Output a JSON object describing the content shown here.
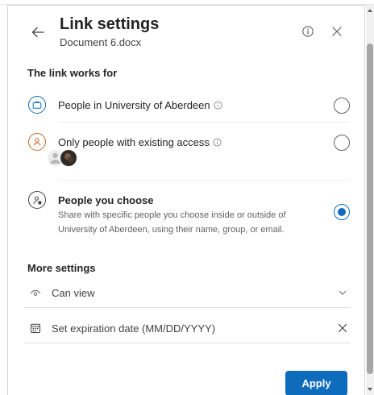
{
  "header": {
    "title": "Link settings",
    "document_name": "Document 6.docx"
  },
  "link_works_for": {
    "heading": "The link works for",
    "options": [
      {
        "label": "People in University of Aberdeen",
        "selected": false
      },
      {
        "label": "Only people with existing access",
        "selected": false
      },
      {
        "label": "People you choose",
        "description": "Share with specific people you choose inside or outside of University of Aberdeen, using their name, group, or email.",
        "selected": true
      }
    ]
  },
  "more_settings": {
    "heading": "More settings",
    "permission": "Can view",
    "expiration_placeholder": "Set expiration date (MM/DD/YYYY)"
  },
  "footer": {
    "apply_label": "Apply"
  },
  "colors": {
    "accent": "#0f6cbd",
    "text": "#242424"
  }
}
